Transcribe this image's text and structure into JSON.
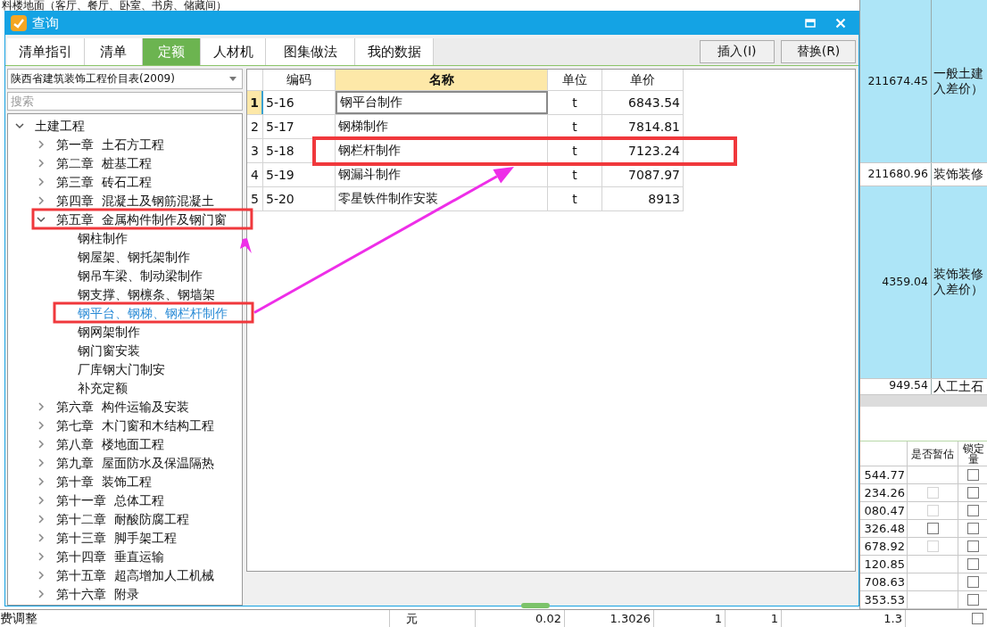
{
  "background": {
    "top_text": "料楼地面（客厅、餐厅、卧室、书房、储藏间）",
    "side_rows": [
      {
        "amount": "211674.45",
        "lines": [
          "一般土建",
          "入差价）"
        ],
        "selected": true
      },
      {
        "amount": "211680.96",
        "lines": [
          "装饰装修"
        ],
        "selected": false
      },
      {
        "amount": "4359.04",
        "lines": [
          "装饰装修",
          "入差价）"
        ],
        "selected": true
      },
      {
        "amount": "949.54",
        "lines": [
          "人工土石"
        ],
        "selected": false
      }
    ],
    "lower_table": {
      "columns": [
        "是否暂估",
        "锁定量"
      ],
      "rows": [
        {
          "value": "544.77",
          "locked": false
        },
        {
          "value": "234.26",
          "estimate": {
            "checked": false,
            "disabled": true
          },
          "locked": false
        },
        {
          "value": "080.47",
          "estimate": {
            "checked": false,
            "disabled": true
          },
          "locked": false
        },
        {
          "value": "326.48",
          "estimate": {
            "checked": false,
            "disabled": false
          },
          "locked": false
        },
        {
          "value": "678.92",
          "estimate": {
            "checked": false,
            "disabled": true
          },
          "locked": false
        },
        {
          "value": "120.85",
          "locked": false
        },
        {
          "value": "708.63",
          "locked": false
        },
        {
          "value": "353.53",
          "locked": false
        }
      ]
    },
    "bottom_row": {
      "cells": [
        "费调整",
        "元",
        "0.02",
        "1.3026",
        "1",
        "1",
        "1.3"
      ],
      "locked": false
    }
  },
  "dialog": {
    "title": "查询",
    "tabs": [
      {
        "label": "清单指引",
        "selected": false
      },
      {
        "label": "清单",
        "selected": false
      },
      {
        "label": "定额",
        "selected": true
      },
      {
        "label": "人材机",
        "selected": false
      },
      {
        "label": "图集做法",
        "selected": false
      },
      {
        "label": "我的数据",
        "selected": false
      }
    ],
    "buttons": [
      "插入(I)",
      "替换(R)"
    ],
    "library": "陕西省建筑装饰工程价目表(2009)",
    "search": {
      "placeholder": "搜索"
    },
    "tree": [
      {
        "label": "土建工程",
        "expanded": true,
        "marked": false,
        "children": [
          {
            "label": "第一章  土石方工程",
            "expanded": false,
            "marked": false
          },
          {
            "label": "第二章  桩基工程",
            "expanded": false,
            "marked": false
          },
          {
            "label": "第三章  砖石工程",
            "expanded": false,
            "marked": false
          },
          {
            "label": "第四章  混凝土及钢筋混凝土",
            "expanded": false,
            "marked": false
          },
          {
            "label": "第五章  金属构件制作及钢门窗",
            "expanded": true,
            "marked": true,
            "children": [
              {
                "label": "钢柱制作",
                "selected": false,
                "marked": false
              },
              {
                "label": "钢屋架、钢托架制作",
                "selected": false,
                "marked": false
              },
              {
                "label": "钢吊车梁、制动梁制作",
                "selected": false,
                "marked": false
              },
              {
                "label": "钢支撑、钢檩条、钢墙架",
                "selected": false,
                "marked": false
              },
              {
                "label": "钢平台、钢梯、钢栏杆制作",
                "selected": true,
                "marked": true
              },
              {
                "label": "钢网架制作",
                "selected": false,
                "marked": false
              },
              {
                "label": "钢门窗安装",
                "selected": false,
                "marked": false
              },
              {
                "label": "厂库钢大门制安",
                "selected": false,
                "marked": false
              },
              {
                "label": "补充定额",
                "selected": false,
                "marked": false
              }
            ]
          },
          {
            "label": "第六章  构件运输及安装",
            "expanded": false,
            "marked": false
          },
          {
            "label": "第七章  木门窗和木结构工程",
            "expanded": false,
            "marked": false
          },
          {
            "label": "第八章  楼地面工程",
            "expanded": false,
            "marked": false
          },
          {
            "label": "第九章  屋面防水及保温隔热",
            "expanded": false,
            "marked": false
          },
          {
            "label": "第十章  装饰工程",
            "expanded": false,
            "marked": false
          },
          {
            "label": "第十一章  总体工程",
            "expanded": false,
            "marked": false
          },
          {
            "label": "第十二章  耐酸防腐工程",
            "expanded": false,
            "marked": false
          },
          {
            "label": "第十三章  脚手架工程",
            "expanded": false,
            "marked": false
          },
          {
            "label": "第十四章  垂直运输",
            "expanded": false,
            "marked": false
          },
          {
            "label": "第十五章  超高增加人工机械",
            "expanded": false,
            "marked": false
          },
          {
            "label": "第十六章  附录",
            "expanded": false,
            "marked": false
          }
        ]
      }
    ],
    "table": {
      "columns": [
        {
          "label": "编码",
          "highlighted": false
        },
        {
          "label": "名称",
          "highlighted": true
        },
        {
          "label": "单位",
          "highlighted": false
        },
        {
          "label": "单价",
          "highlighted": false
        }
      ],
      "rows": [
        {
          "number": "1",
          "code": "5-16",
          "name": "钢平台制作",
          "unit": "t",
          "price": "6843.54",
          "selected": true,
          "marked": false
        },
        {
          "number": "2",
          "code": "5-17",
          "name": "钢梯制作",
          "unit": "t",
          "price": "7814.81",
          "selected": false,
          "marked": false
        },
        {
          "number": "3",
          "code": "5-18",
          "name": "钢栏杆制作",
          "unit": "t",
          "price": "7123.24",
          "selected": false,
          "marked": true
        },
        {
          "number": "4",
          "code": "5-19",
          "name": "钢漏斗制作",
          "unit": "t",
          "price": "7087.97",
          "selected": false,
          "marked": false
        },
        {
          "number": "5",
          "code": "5-20",
          "name": "零星铁件制作安装",
          "unit": "t",
          "price": "8913",
          "selected": false,
          "marked": false
        }
      ]
    },
    "annotation_arrow": true
  }
}
